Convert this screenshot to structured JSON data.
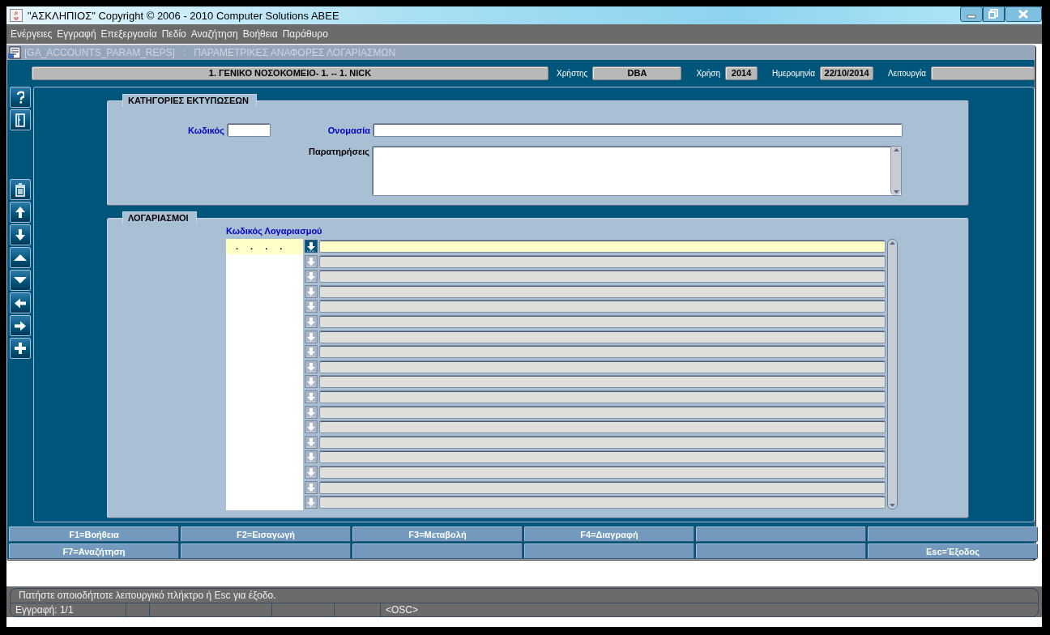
{
  "window": {
    "title": "\"ΑΣΚΛΗΠΙΟΣ\" Copyright © 2006 - 2010 Computer Solutions ABEE"
  },
  "menu": [
    "Ενέργειες",
    "Εγγραφή",
    "Επεξεργασία",
    "Πεδίο",
    "Αναζήτηση",
    "Βοήθεια",
    "Παράθυρο"
  ],
  "form": {
    "title": "[GA_ACCOUNTS_PARAM_REPS]   :   ΠΑΡΑΜΕΤΡΙΚΕΣ ΑΝΑΦΟΡΕΣ ΛΟΓΑΡΙΑΣΜΩΝ"
  },
  "header": {
    "organization": "1. ΓΕΝΙΚΟ ΝΟΣΟΚΟΜΕΙΟ- 1. -- 1. NICK",
    "fields": [
      {
        "label": "Χρήστης",
        "value": "DBA"
      },
      {
        "label": "Χρήση",
        "value": "2014"
      },
      {
        "label": "Ημερομηνία",
        "value": "22/10/2014"
      },
      {
        "label": "Λειτουργία"
      }
    ]
  },
  "toolbar": {
    "top": [
      {
        "kind": "help"
      },
      {
        "kind": "exit"
      }
    ],
    "bottom": [
      {
        "kind": "delete"
      },
      {
        "kind": "first"
      },
      {
        "kind": "last"
      },
      {
        "kind": "previous"
      },
      {
        "kind": "next"
      },
      {
        "kind": "left"
      },
      {
        "kind": "right"
      },
      {
        "kind": "add"
      }
    ]
  },
  "categories": {
    "title": "ΚΑΤΗΓΟΡΙΕΣ ΕΚΤΥΠΩΣΕΩΝ",
    "code_label": "Κωδικός",
    "name_label": "Ονομασία",
    "notes_label": "Παρατηρήσεις"
  },
  "accounts": {
    "title": "ΛΟΓΑΡΙΑΣΜΟΙ",
    "column": "Κωδικός Λογαριασμού",
    "rows": [
      {
        "code": ". . . .",
        "selected": true
      },
      {
        "selected": false
      },
      {
        "selected": false
      },
      {
        "selected": false
      },
      {
        "selected": false
      },
      {
        "selected": false
      },
      {
        "selected": false
      },
      {
        "selected": false
      },
      {
        "selected": false
      },
      {
        "selected": false
      },
      {
        "selected": false
      },
      {
        "selected": false
      },
      {
        "selected": false
      },
      {
        "selected": false
      },
      {
        "selected": false
      },
      {
        "selected": false
      },
      {
        "selected": false
      },
      {
        "selected": false
      }
    ]
  },
  "function_keys": [
    {
      "kind": "key",
      "label": "F1=Βοήθεια"
    },
    {
      "kind": "key",
      "label": "F2=Εισαγωγή"
    },
    {
      "kind": "key",
      "label": "F3=Μεταβολή"
    },
    {
      "kind": "key",
      "label": "F4=Διαγραφή"
    },
    {
      "kind": "blank"
    },
    {
      "kind": "blank"
    },
    {
      "kind": "key",
      "label": "F7=Αναζήτηση"
    },
    {
      "kind": "blank"
    },
    {
      "kind": "blank"
    },
    {
      "kind": "blank"
    },
    {
      "kind": "blank"
    },
    {
      "kind": "key",
      "label": "Esc=Έξοδος"
    }
  ],
  "status_bar": {
    "message": "Πατήστε οποιοδήποτε λειτουργικό πλήκτρο ή Esc για έξοδο.",
    "record": "Εγγραφή: 1/1",
    "mode": "<OSC>"
  }
}
